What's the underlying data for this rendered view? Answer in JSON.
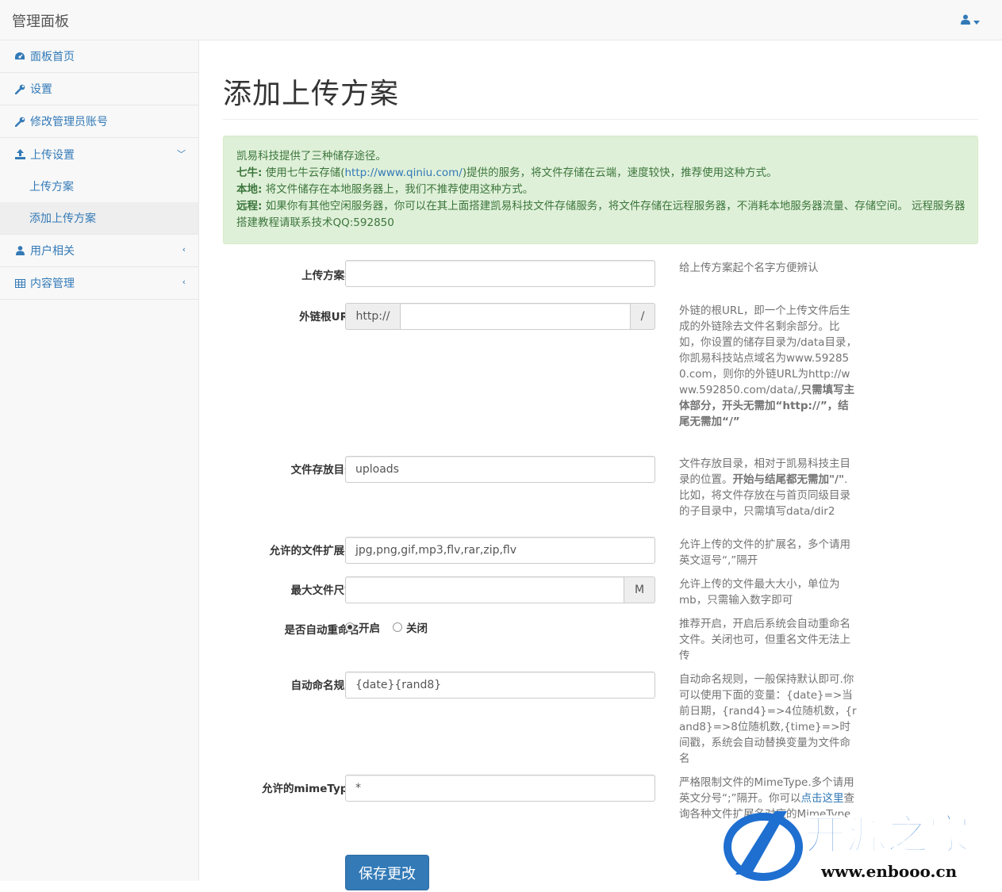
{
  "header": {
    "brand": "管理面板",
    "user_caret": "▾"
  },
  "sidebar": {
    "items": [
      {
        "label": "面板首页",
        "icon": "dashboard-icon"
      },
      {
        "label": "设置",
        "icon": "wrench-icon"
      },
      {
        "label": "修改管理员账号",
        "icon": "wrench-icon"
      },
      {
        "label": "上传设置",
        "icon": "upload-icon",
        "chevron": "﹀"
      },
      {
        "label": "用户相关",
        "icon": "user-icon",
        "chevron": "‹"
      },
      {
        "label": "内容管理",
        "icon": "table-icon",
        "chevron": "‹"
      }
    ],
    "sub_items": [
      {
        "label": "上传方案"
      },
      {
        "label": "添加上传方案"
      }
    ]
  },
  "page": {
    "title": "添加上传方案"
  },
  "alert": {
    "line1": "凯易科技提供了三种储存途径。",
    "l2_key": "七牛:",
    "l2_a": " 使用七牛云存储(",
    "l2_link": "http://www.qiniu.com/",
    "l2_b": ")提供的服务，将文件存储在云端，速度较快，推荐使用这种方式。",
    "l3_key": "本地:",
    "l3_text": " 将文件储存在本地服务器上，我们不推荐使用这种方式。",
    "l4_key": "远程:",
    "l4_text": " 如果你有其他空闲服务器，你可以在其上面搭建凯易科技文件存储服务，将文件存储在远程服务器，不消耗本地服务器流量、存储空间。 远程服务器搭建教程请联系技术QQ:592850"
  },
  "form": {
    "name": {
      "label": "上传方案名:",
      "value": "",
      "help": "给上传方案起个名字方便辨认"
    },
    "url": {
      "label": "外链根URL:",
      "prefix": "http://",
      "value": "",
      "suffix": "/",
      "help_a": "外链的根URL，即一个上传文件后生成的外链除去文件名剩余部分。比如，你设置的储存目录为/data目录，你凯易科技站点域名为www.592850.com，则你的外链URL为http://www.592850.com/data/,",
      "help_b": "只需填写主体部分，开头无需加“http://”，结尾无需加“/”"
    },
    "dir": {
      "label": "文件存放目录:",
      "value": "uploads",
      "help_a": "文件存放目录，相对于凯易科技主目录的位置。",
      "help_b": "开始与结尾都无需加\"/\"",
      "help_c": ".比如，将文件存放在与首页同级目录的子目录中，只需填写data/dir2"
    },
    "ext": {
      "label": "允许的文件扩展名:",
      "value": "jpg,png,gif,mp3,flv,rar,zip,flv",
      "help": "允许上传的文件的扩展名，多个请用英文逗号“,”隔开"
    },
    "size": {
      "label": "最大文件尺寸:",
      "value": "",
      "suffix": "M",
      "help": "允许上传的文件最大大小，单位为mb，只需输入数字即可"
    },
    "rename": {
      "label": "是否自动重命名",
      "on_label": "开启",
      "off_label": "关闭",
      "help": "推荐开启，开启后系统会自动重命名文件。关闭也可，但重名文件无法上传"
    },
    "rule": {
      "label": "自动命名规则:",
      "value": "{date}{rand8}",
      "help": "自动命名规则，一般保持默认即可.你可以使用下面的变量：{date}=>当前日期，{rand4}=>4位随机数，{rand8}=>8位随机数,{time}=>时间戳，系统会自动替换变量为文件命名"
    },
    "mime": {
      "label": "允许的mimeType:",
      "value": "*",
      "help_a": "严格限制文件的MimeType.多个请用英文分号“;”隔开。你可以",
      "help_link": "点击这里",
      "help_b": "查询各种文件扩展名对应的MimeType"
    },
    "save_label": "保存更改"
  },
  "watermark": {
    "text": "开源之家",
    "url": "www.enbooo.cn"
  },
  "colors": {
    "accent": "#337ab7",
    "alert_bg": "#dff0d8",
    "alert_text": "#3c763d"
  }
}
